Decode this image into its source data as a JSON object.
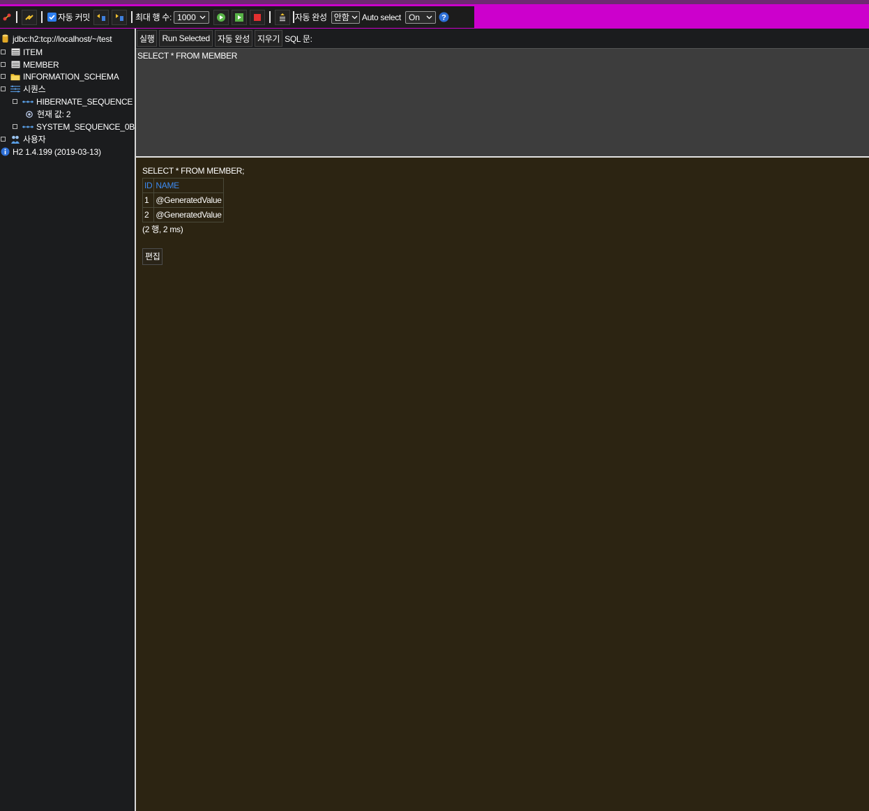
{
  "toolbar": {
    "auto_commit_label": "자동 커밋",
    "max_rows_label": "최대 행 수:",
    "max_rows_value": "1000",
    "auto_complete_label": "자동 완성",
    "auto_complete_value": "안함",
    "auto_select_label": "Auto select",
    "auto_select_value": "On"
  },
  "tree": {
    "connection": "jdbc:h2:tcp://localhost/~/test",
    "items": [
      {
        "label": "ITEM"
      },
      {
        "label": "MEMBER"
      },
      {
        "label": "INFORMATION_SCHEMA"
      },
      {
        "label": "시퀀스"
      },
      {
        "label": "HIBERNATE_SEQUENCE"
      },
      {
        "label": "현재 값: 2"
      },
      {
        "label": "SYSTEM_SEQUENCE_0B"
      },
      {
        "label": "사용자"
      }
    ],
    "version": "H2 1.4.199 (2019-03-13)"
  },
  "commands": {
    "run": "실행",
    "run_selected": "Run Selected",
    "auto_complete": "자동 완성",
    "clear": "지우기",
    "sql_label": "SQL 문:"
  },
  "editor": {
    "sql": "SELECT * FROM MEMBER"
  },
  "results": {
    "statement": "SELECT * FROM MEMBER;",
    "columns": [
      "ID",
      "NAME"
    ],
    "rows": [
      [
        "1",
        "@GeneratedValue"
      ],
      [
        "2",
        "@GeneratedValue"
      ]
    ],
    "summary": "(2 행, 2 ms)",
    "edit_label": "편집"
  }
}
